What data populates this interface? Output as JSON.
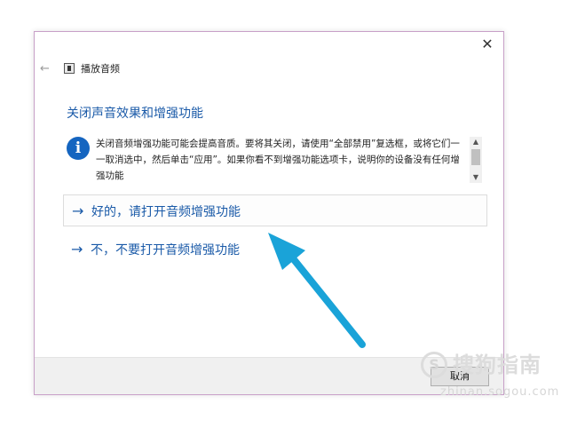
{
  "window": {
    "title": "播放音频",
    "close_glyph": "✕",
    "back_glyph": "←"
  },
  "main": {
    "heading": "关闭声音效果和增强功能",
    "info_text": "关闭音频增强功能可能会提高音质。要将其关闭，请使用“全部禁用”复选框，或将它们一一取消选中，然后单击“应用”。如果你看不到增强功能选项卡，说明你的设备没有任何增强功能",
    "options": [
      {
        "label": "好的，请打开音频增强功能"
      },
      {
        "label": "不，不要打开音频增强功能"
      }
    ]
  },
  "footer": {
    "cancel_label": "取消"
  },
  "watermark": {
    "logo_glyph": "S",
    "brand": "搜狗指南",
    "url": "zhinan.sogou.com"
  },
  "colors": {
    "link_blue": "#1a5aa8",
    "info_icon_blue": "#1565c0",
    "pointer_arrow": "#1aa3d8"
  },
  "icons": {
    "info": "info-icon",
    "back": "back-arrow-icon",
    "close": "close-icon",
    "option_arrow": "right-arrow-icon"
  }
}
